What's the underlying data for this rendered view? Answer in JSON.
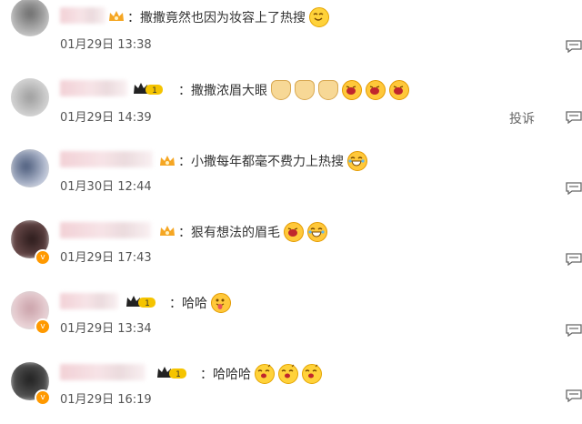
{
  "comments": [
    {
      "text": "：撒撒竟然也因为妆容上了热搜",
      "time": "01月29日 13:38",
      "emojis": [
        "smile-emoji"
      ]
    },
    {
      "text": "：撒撒浓眉大眼",
      "time": "01月29日 14:39",
      "emojis": [
        "dog-emoji",
        "dog-emoji",
        "dog-emoji",
        "laugh-emoji",
        "laugh-emoji",
        "laugh-emoji"
      ],
      "report_label": "投诉"
    },
    {
      "text": "：小撒每年都毫不费力上热搜",
      "time": "01月30日 12:44",
      "emojis": [
        "tears-laugh-emoji"
      ]
    },
    {
      "text": "：狠有想法的眉毛",
      "time": "01月29日 17:43",
      "emojis": [
        "laugh-emoji",
        "tears-laugh-emoji"
      ]
    },
    {
      "text": "：哈哈",
      "time": "01月29日 13:34",
      "emojis": [
        "tongue-emoji"
      ]
    },
    {
      "text": "：哈哈哈",
      "time": "01月29日 16:19",
      "emojis": [
        "drool-emoji",
        "drool-emoji",
        "drool-emoji"
      ]
    }
  ],
  "badges": {
    "vip_level": "1"
  },
  "colors": {
    "crown": "#f5a623",
    "vip_badge": "#e6b800",
    "verified": "#ff9900"
  }
}
